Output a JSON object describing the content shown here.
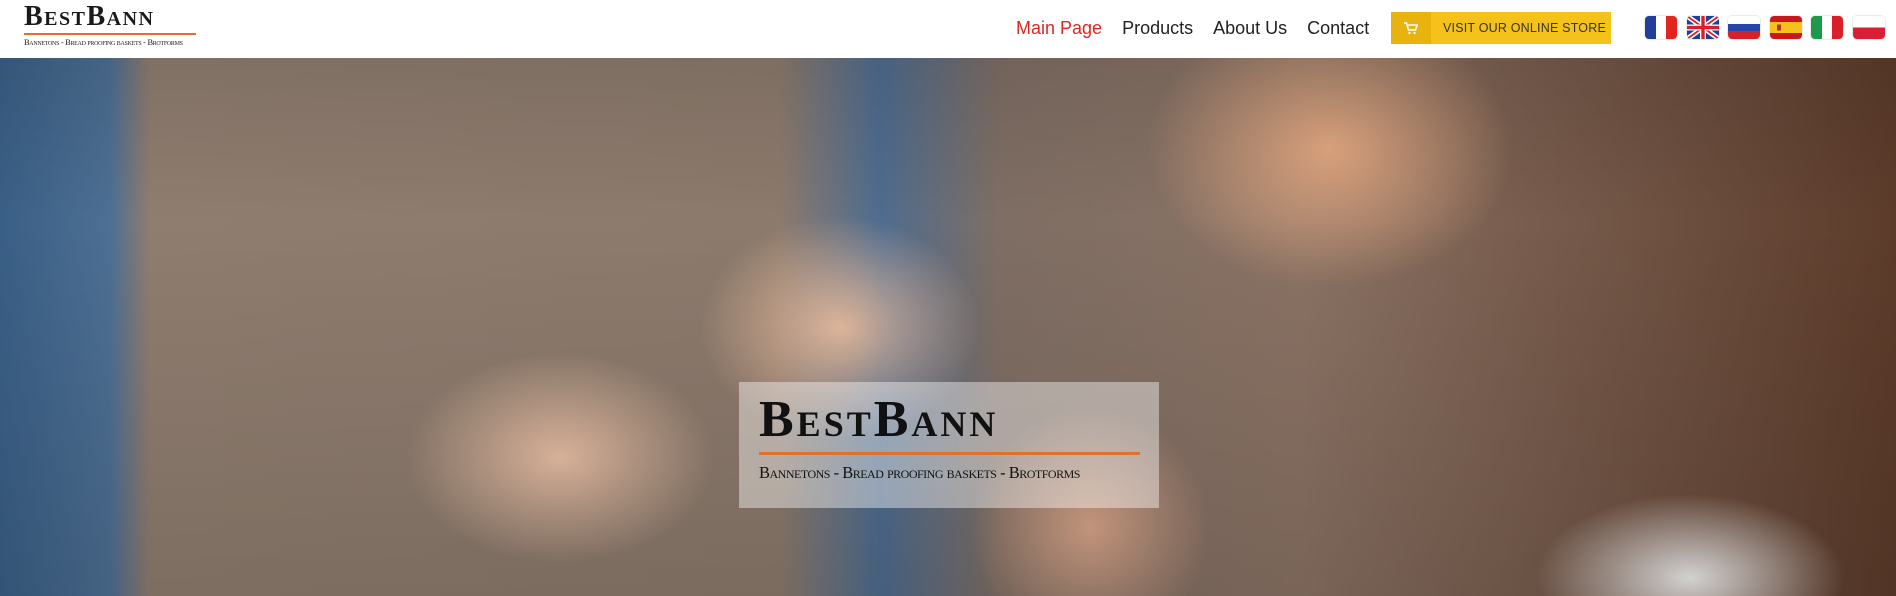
{
  "brand": {
    "name": "BestBann",
    "tagline": "Bannetons - Bread proofing baskets - Brotforms",
    "accent": "#e0702a"
  },
  "nav": {
    "items": [
      {
        "label": "Main Page",
        "active": true
      },
      {
        "label": "Products",
        "active": false
      },
      {
        "label": "About Us",
        "active": false
      },
      {
        "label": "Contact",
        "active": false
      }
    ],
    "active_color": "#e0261e"
  },
  "store_button": {
    "label": "VISIT OUR ONLINE STORE",
    "icon": "cart-icon",
    "color": "#f5c21b"
  },
  "languages": [
    "french-flag-icon",
    "uk-flag-icon",
    "russian-flag-icon",
    "spanish-flag-icon",
    "italian-flag-icon",
    "polish-flag-icon"
  ],
  "hero": {
    "brand_name": "BestBann",
    "tagline": "Bannetons - Bread proofing baskets - Brotforms"
  }
}
